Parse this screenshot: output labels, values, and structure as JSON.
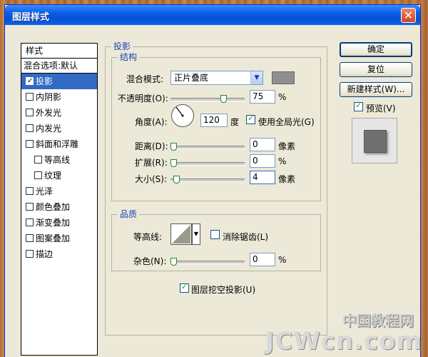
{
  "window": {
    "title": "图层样式",
    "close_glyph": "✕"
  },
  "style_list": {
    "header": "样式",
    "blend_options": "混合选项:默认",
    "items": [
      {
        "label": "投影",
        "checked": true,
        "selected": true,
        "indent": false
      },
      {
        "label": "内阴影",
        "checked": false,
        "selected": false,
        "indent": false
      },
      {
        "label": "外发光",
        "checked": false,
        "selected": false,
        "indent": false
      },
      {
        "label": "内发光",
        "checked": false,
        "selected": false,
        "indent": false
      },
      {
        "label": "斜面和浮雕",
        "checked": false,
        "selected": false,
        "indent": false
      },
      {
        "label": "等高线",
        "checked": false,
        "selected": false,
        "indent": true
      },
      {
        "label": "纹理",
        "checked": false,
        "selected": false,
        "indent": true
      },
      {
        "label": "光泽",
        "checked": false,
        "selected": false,
        "indent": false
      },
      {
        "label": "颜色叠加",
        "checked": false,
        "selected": false,
        "indent": false
      },
      {
        "label": "渐变叠加",
        "checked": false,
        "selected": false,
        "indent": false
      },
      {
        "label": "图案叠加",
        "checked": false,
        "selected": false,
        "indent": false
      },
      {
        "label": "描边",
        "checked": false,
        "selected": false,
        "indent": false
      }
    ]
  },
  "drop_shadow": {
    "title": "投影",
    "structure": {
      "title": "结构",
      "blend_mode_label": "混合模式:",
      "blend_mode_value": "正片叠底",
      "shadow_color": "#8f8f8f",
      "opacity_label": "不透明度(O):",
      "opacity_value": "75",
      "opacity_unit": "%",
      "angle_label": "角度(A):",
      "angle_value": "120",
      "angle_unit": "度",
      "global_light_label": "使用全局光(G)",
      "global_light_checked": true,
      "distance_label": "距离(D):",
      "distance_value": "0",
      "distance_unit": "像素",
      "spread_label": "扩展(R):",
      "spread_value": "0",
      "spread_unit": "%",
      "size_label": "大小(S):",
      "size_value": "4",
      "size_unit": "像素"
    },
    "quality": {
      "title": "品质",
      "contour_label": "等高线:",
      "antialias_label": "消除锯齿(L)",
      "antialias_checked": false,
      "noise_label": "杂色(N):",
      "noise_value": "0",
      "noise_unit": "%"
    },
    "knockout_label": "图层挖空投影(U)",
    "knockout_checked": true
  },
  "buttons": {
    "ok": "确定",
    "reset": "复位",
    "new_style": "新建样式(W)...",
    "preview_label": "预览(V)",
    "preview_checked": true
  },
  "watermark": {
    "cn": "中国教程网",
    "en": "JCWcn.com"
  }
}
